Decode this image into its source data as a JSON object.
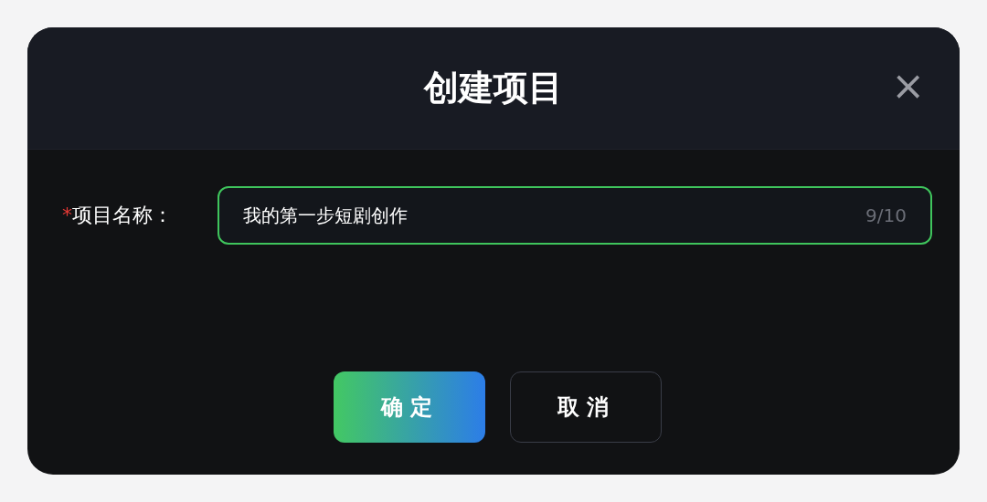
{
  "dialog": {
    "title": "创建项目",
    "close_icon": "×"
  },
  "field": {
    "label": "项目名称：",
    "required_mark": "*",
    "value": "我的第一步短剧创作",
    "counter": "9/10",
    "focused": true
  },
  "buttons": [
    {
      "label": "确定",
      "kind": "primary"
    },
    {
      "label": "取消",
      "kind": "secondary"
    }
  ]
}
